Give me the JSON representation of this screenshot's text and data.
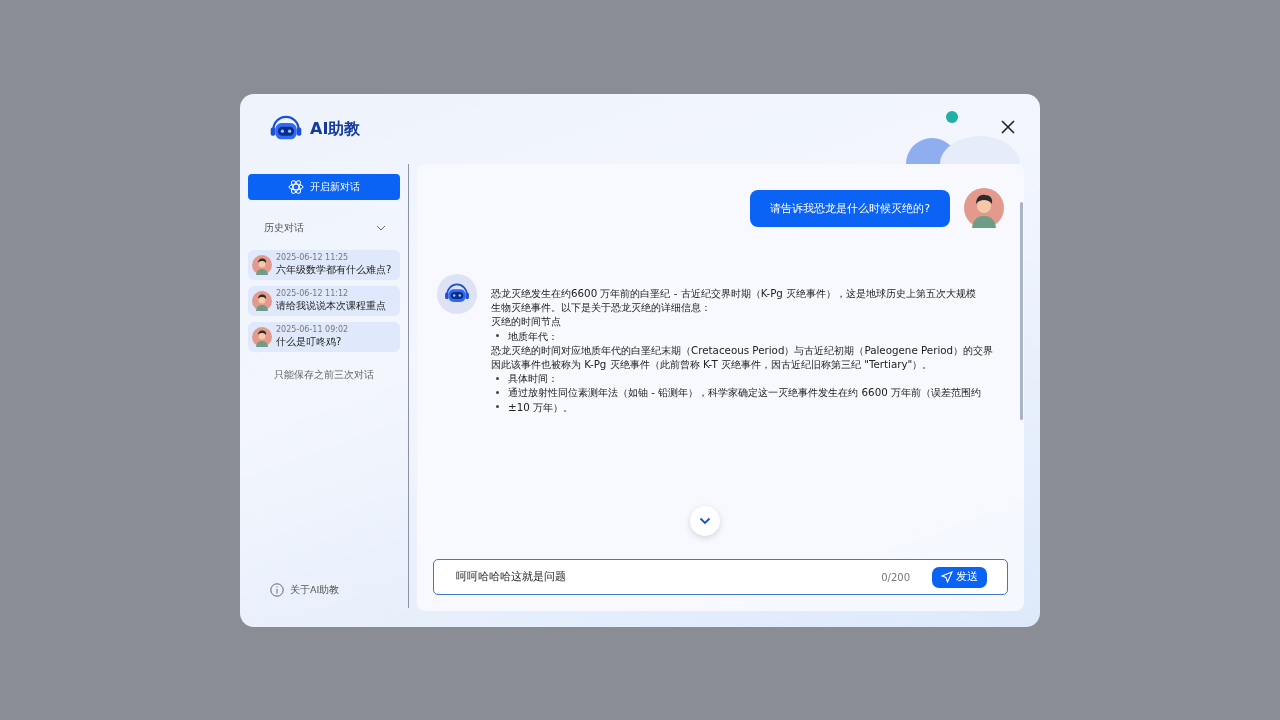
{
  "app": {
    "title": "AI助教"
  },
  "sidebar": {
    "new_chat_button": "开启新对话",
    "history": {
      "label": "历史对话",
      "expanded": true
    },
    "conversations": [
      {
        "time": "2025-06-12 11:25",
        "title": "六年级数学都有什么难点?",
        "selected": false
      },
      {
        "time": "2025-06-12 11:12",
        "title": "请给我说说本次课程重点",
        "selected": false
      },
      {
        "time": "2025-06-11 09:02",
        "title": "什么是叮咚鸡?",
        "selected": false
      }
    ],
    "note": "只能保存之前三次对话",
    "about": "关于AI助教"
  },
  "chat": {
    "messages": [
      {
        "kind": "user",
        "text": "请告诉我恐龙是什么时候灭绝的?"
      },
      {
        "kind": "assistant",
        "lines": [
          {
            "kind": "text",
            "text": "恐龙灭绝发生在约6600 万年前的白垩纪 - 古近纪交界时期（K-Pg 灭绝事件），这是地球历史上第五次大规模"
          },
          {
            "kind": "text",
            "text": "生物灭绝事件。以下是关于恐龙灭绝的详细信息："
          },
          {
            "kind": "text",
            "text": "灭绝的时间节点"
          },
          {
            "kind": "bullet",
            "text": "地质年代："
          },
          {
            "kind": "text",
            "text": "恐龙灭绝的时间对应地质年代的白垩纪末期（Cretaceous Period）与古近纪初期（Paleogene Period）的交界"
          },
          {
            "kind": "text",
            "text": "因此该事件也被称为 K-Pg 灭绝事件（此前曾称 K-T 灭绝事件，因古近纪旧称第三纪 \"Tertiary\"）。"
          },
          {
            "kind": "bullet",
            "text": "具体时间："
          },
          {
            "kind": "bullet",
            "text": "通过放射性同位素测年法（如铀 - 铅测年），科学家确定这一灭绝事件发生在约 6600 万年前（误差范围约"
          },
          {
            "kind": "bullet",
            "text": "±10 万年）。"
          }
        ]
      }
    ],
    "input": {
      "value": "呵呵哈哈哈这就是问题",
      "counter": "0/200",
      "send_button": "发送"
    }
  }
}
